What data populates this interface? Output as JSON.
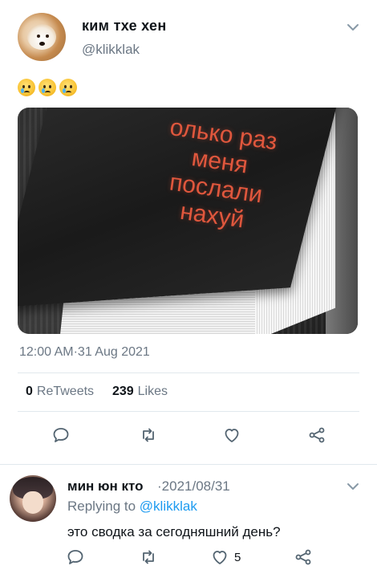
{
  "tweet": {
    "display_name": "ким тхе хен",
    "handle": "@klikklak",
    "emoji_text": "😢😢😢",
    "image_text_lines": [
      "олько раз",
      "меня",
      "послали",
      "нахуй"
    ],
    "timestamp": "12:00 AM·31 Aug 2021",
    "stats": {
      "retweets_count": "0",
      "retweets_label": "ReTweets",
      "likes_count": "239",
      "likes_label": "Likes"
    },
    "actions": {
      "reply_icon": "reply-icon",
      "retweet_icon": "retweet-icon",
      "like_icon": "heart-icon",
      "share_icon": "share-icon"
    }
  },
  "reply": {
    "display_name": "мин юн кто",
    "date": "·2021/08/31",
    "replying_prefix": "Replying to",
    "replying_mention": "@klikklak",
    "text": "это сводка за сегодняшний день?",
    "like_count": "5"
  },
  "colors": {
    "accent": "#1d9bf0",
    "muted": "#6b7784",
    "divider": "#e1e8ed",
    "cover_text": "#e0573d"
  }
}
